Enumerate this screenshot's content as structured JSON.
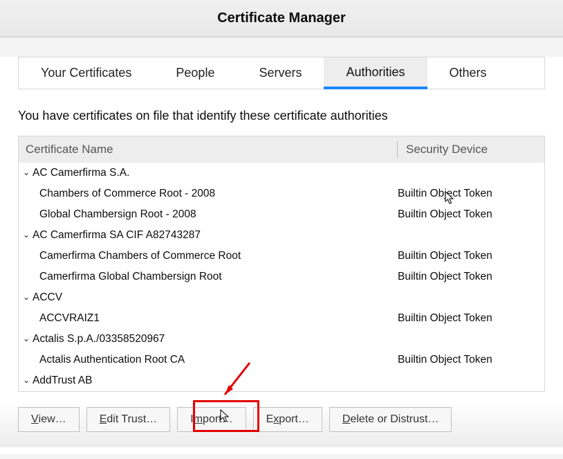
{
  "header": {
    "title": "Certificate Manager"
  },
  "tabs": {
    "your_certificates": "Your Certificates",
    "people": "People",
    "servers": "Servers",
    "authorities": "Authorities",
    "others": "Others",
    "active": "authorities"
  },
  "description": "You have certificates on file that identify these certificate authorities",
  "columns": {
    "name": "Certificate Name",
    "device": "Security Device"
  },
  "tree": [
    {
      "group": "AC Camerfirma S.A.",
      "rows": [
        {
          "name": "Chambers of Commerce Root - 2008",
          "device": "Builtin Object Token"
        },
        {
          "name": "Global Chambersign Root - 2008",
          "device": "Builtin Object Token"
        }
      ]
    },
    {
      "group": "AC Camerfirma SA CIF A82743287",
      "rows": [
        {
          "name": "Camerfirma Chambers of Commerce Root",
          "device": "Builtin Object Token"
        },
        {
          "name": "Camerfirma Global Chambersign Root",
          "device": "Builtin Object Token"
        }
      ]
    },
    {
      "group": "ACCV",
      "rows": [
        {
          "name": "ACCVRAIZ1",
          "device": "Builtin Object Token"
        }
      ]
    },
    {
      "group": "Actalis S.p.A./03358520967",
      "rows": [
        {
          "name": "Actalis Authentication Root CA",
          "device": "Builtin Object Token"
        }
      ]
    },
    {
      "group": "AddTrust AB",
      "rows": []
    }
  ],
  "buttons": {
    "view": "View…",
    "edit_trust": "Edit Trust…",
    "import": "Import…",
    "export": "Export…",
    "delete_distrust": "Delete or Distrust…"
  },
  "accelerators": {
    "view": "V",
    "edit_trust": "E",
    "import": "m",
    "export": "x",
    "delete_distrust": "D"
  }
}
